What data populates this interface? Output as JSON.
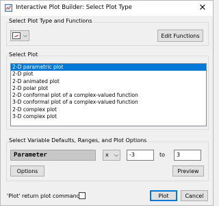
{
  "window": {
    "title": "Interactive Plot Builder: Select Plot Type",
    "close_glyph": "✕"
  },
  "plot_type_group": {
    "label": "Select Plot Type and Functions",
    "edit_functions_button": "Edit Functions",
    "type_selector_chevron": "⌵"
  },
  "plot_group": {
    "label": "Select Plot",
    "items": [
      "2-D parametric plot",
      "2-D plot",
      "2-D animated plot",
      "2-D polar plot",
      "2-D conformal plot of a complex-valued function",
      "3-D conformal plot of a complex-valued function",
      "2-D complex plot",
      "3-D complex plot"
    ],
    "selected_index": 0
  },
  "variable_group": {
    "label": "Select Variable Defaults, Ranges, and Plot Options",
    "parameter_label": "Parameter",
    "variable": "x",
    "variable_chevron": "⌵",
    "range_from": "-3",
    "to_label": "to",
    "range_to": "3",
    "options_button": "Options",
    "preview_button": "Preview"
  },
  "footer": {
    "checkbox_label": "'Plot' return plot command",
    "checkbox_checked": false,
    "plot_button": "Plot",
    "cancel_button": "Cancel"
  },
  "colors": {
    "selection": "#0078d7",
    "window_bg": "#f0f0f0",
    "parameter_field_bg": "#c8c8c8"
  }
}
